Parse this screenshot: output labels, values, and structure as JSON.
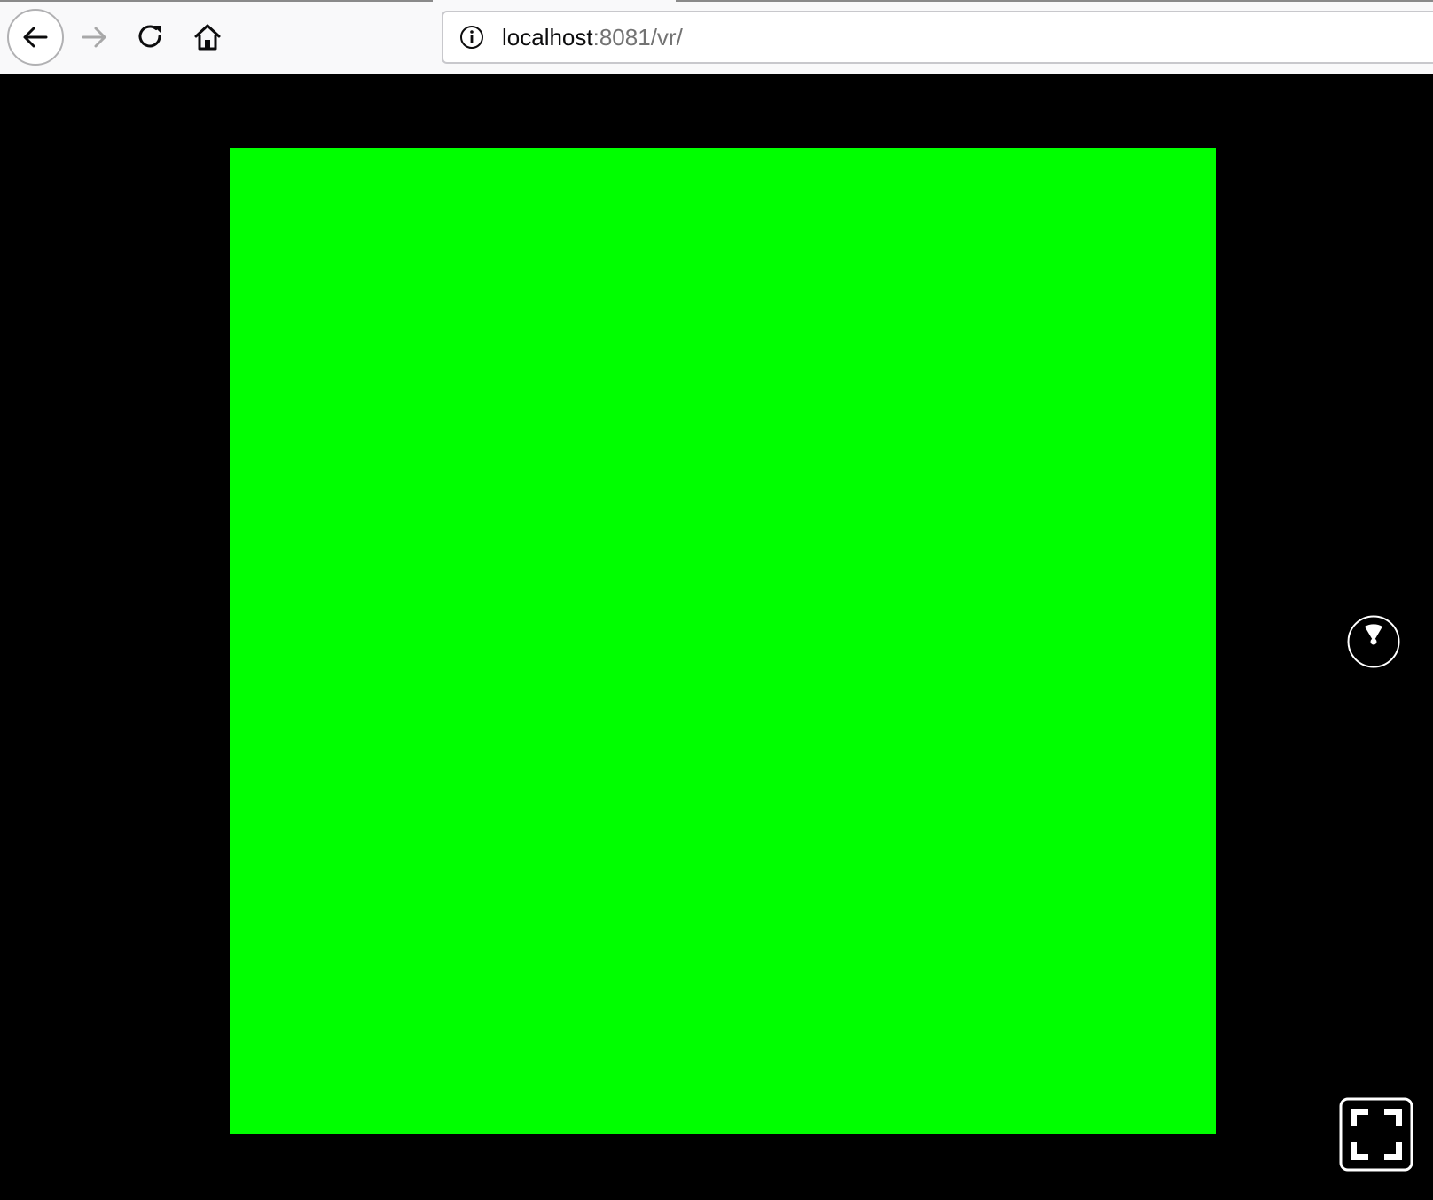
{
  "browser": {
    "url_host": "localhost",
    "url_rest": ":8081/vr/",
    "toolbar_bg": "#f9f9fa",
    "icons": {
      "back": "arrow-left-icon",
      "forward": "arrow-right-icon",
      "reload": "reload-icon",
      "home": "home-icon",
      "site_info": "info-icon"
    }
  },
  "scene": {
    "background_color": "#000000",
    "box_color": "#00ff00",
    "vr_button_icon": "vr-radar-icon",
    "fullscreen_icon": "fullscreen-icon"
  }
}
